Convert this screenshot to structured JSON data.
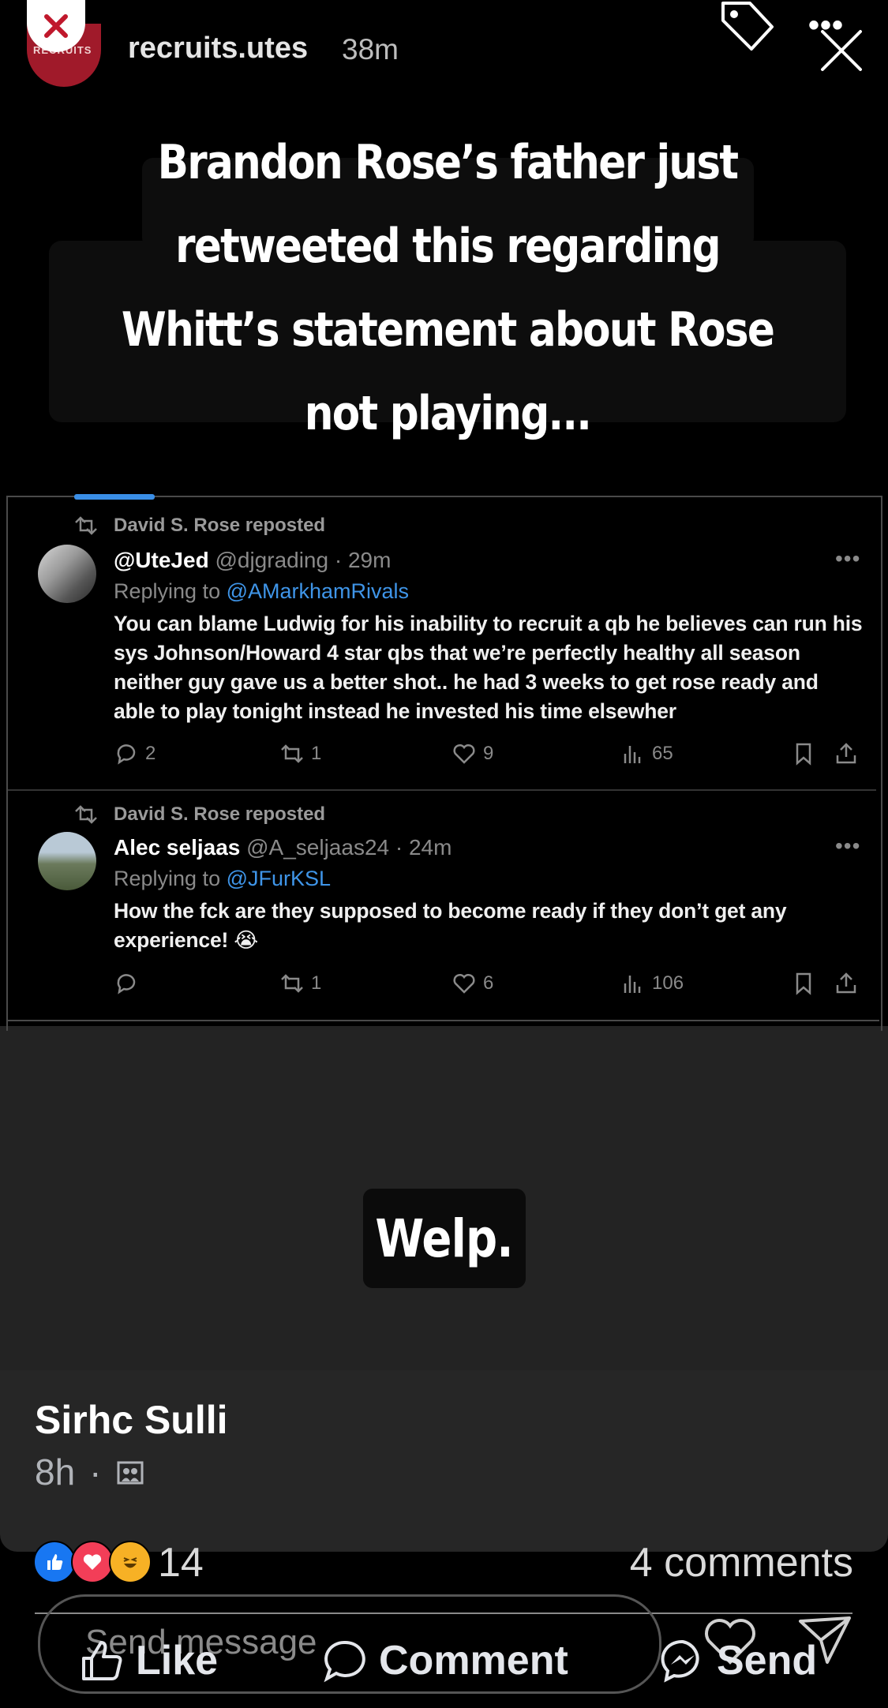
{
  "story": {
    "username": "recruits.utes",
    "time_ago": "38m",
    "avatar_text": "RECRUITS",
    "headline": "Brandon Rose’s father just retweeted this regarding Whitt’s statement about Rose not playing...",
    "caption": "Welp."
  },
  "tweets": [
    {
      "repost_label": "David S. Rose reposted",
      "name": "@UteJed",
      "handle_time": "@djgrading · 29m",
      "replying_prefix": "Replying to ",
      "replying_to": "@AMarkhamRivals",
      "body": "You can blame Ludwig for his inability to recruit a qb he believes can run his sys Johnson/Howard 4 star qbs that we’re perfectly healthy all season neither guy gave us a better shot.. he had 3 weeks to get rose ready and able to play tonight instead he invested his time elsewher",
      "replies": "2",
      "reposts": "1",
      "likes": "9",
      "views": "65"
    },
    {
      "repost_label": "David S. Rose reposted",
      "name": "Alec seljaas",
      "handle_time": "@A_seljaas24 · 24m",
      "replying_prefix": "Replying to ",
      "replying_to": "@JFurKSL",
      "body": "How the fck are they supposed to become ready if they don’t get any experience! 😭",
      "replies": "",
      "reposts": "1",
      "likes": "6",
      "views": "106"
    }
  ],
  "post": {
    "poster_name": "Sirhc Sulli",
    "post_time": "8h",
    "separator": "·",
    "reaction_count": "14",
    "comments_label": "4 comments",
    "send_placeholder": "Send message",
    "actions": {
      "like": "Like",
      "comment": "Comment",
      "send": "Send"
    }
  },
  "colors": {
    "accent_blue": "#3f95e8",
    "like_blue": "#1877f2",
    "love_red": "#f33e58",
    "haha_yellow": "#f7b125",
    "avatar_red": "#a01a2a"
  },
  "icons": [
    "close-icon",
    "tag-icon",
    "more-icon",
    "x-icon",
    "repost-icon",
    "reply-icon",
    "retweet-icon",
    "heart-icon",
    "views-icon",
    "bookmark-icon",
    "share-icon",
    "privacy-icon",
    "like-reaction-icon",
    "love-reaction-icon",
    "haha-reaction-icon",
    "heart-outline-icon",
    "paper-plane-icon",
    "thumbs-up-icon",
    "comment-bubble-icon",
    "messenger-icon"
  ]
}
